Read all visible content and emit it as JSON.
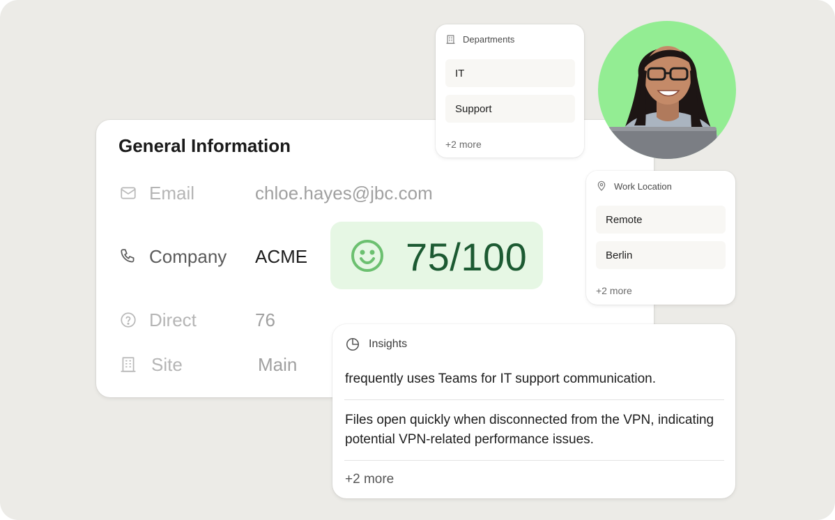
{
  "general": {
    "title": "General Information",
    "rows": [
      {
        "label": "Email",
        "value": "chloe.hayes@jbc.com"
      },
      {
        "label": "Company",
        "value": "ACME"
      },
      {
        "label": "Direct",
        "value": "76"
      },
      {
        "label": "Site",
        "value": "Main"
      }
    ]
  },
  "score": {
    "value": "75/100",
    "color": "#1c5a32",
    "background": "#e6f7e4"
  },
  "departments": {
    "title": "Departments",
    "items": [
      "IT",
      "Support"
    ],
    "more": "+2 more"
  },
  "work_location": {
    "title": "Work Location",
    "items": [
      "Remote",
      "Berlin"
    ],
    "more": "+2 more"
  },
  "insights": {
    "title": "Insights",
    "items": [
      "frequently uses Teams for IT support communication.",
      "Files open quickly when disconnected from the VPN, indicating potential VPN-related performance issues."
    ],
    "more": "+2 more"
  },
  "colors": {
    "canvas": "#ecebe7",
    "avatar_bg": "#93ed93",
    "accent_green": "#6cc070"
  },
  "icons": [
    "mail-icon",
    "phone-icon",
    "help-circle-icon",
    "building-icon",
    "smile-icon",
    "map-pin-icon",
    "pie-chart-icon"
  ]
}
